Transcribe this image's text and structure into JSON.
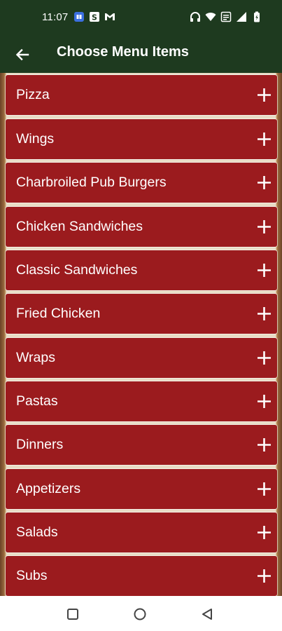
{
  "status_bar": {
    "time": "11:07",
    "left_icons": [
      "app-notification-icon",
      "s-app-icon",
      "gmail-icon"
    ],
    "right_icons": [
      "headphones-icon",
      "wifi-icon",
      "volte-icon",
      "signal-icon",
      "battery-icon"
    ]
  },
  "app_bar": {
    "title": "Choose Menu Items",
    "back_icon": "arrow-left-icon"
  },
  "menu": {
    "items": [
      {
        "label": "Pizza"
      },
      {
        "label": "Wings"
      },
      {
        "label": "Charbroiled Pub Burgers"
      },
      {
        "label": "Chicken Sandwiches"
      },
      {
        "label": "Classic Sandwiches"
      },
      {
        "label": "Fried Chicken"
      },
      {
        "label": "Wraps"
      },
      {
        "label": "Pastas"
      },
      {
        "label": "Dinners"
      },
      {
        "label": "Appetizers"
      },
      {
        "label": "Salads"
      },
      {
        "label": "Subs"
      }
    ],
    "expand_icon": "plus-icon"
  },
  "nav_bar": {
    "buttons": [
      "recents-square-icon",
      "home-circle-icon",
      "back-triangle-icon"
    ]
  },
  "colors": {
    "header_bg": "#1e3a1f",
    "item_bg": "#9b1b1e",
    "text": "#ffffff"
  }
}
